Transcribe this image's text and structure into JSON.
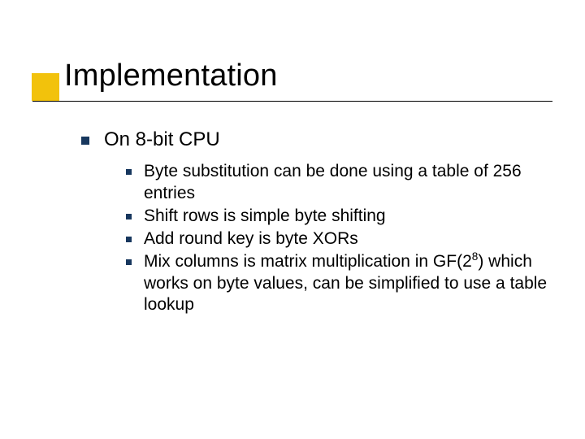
{
  "title": "Implementation",
  "bullets": {
    "level1": "On 8-bit CPU",
    "level2": [
      "Byte substitution can be done using a table of 256 entries",
      "Shift rows is simple byte shifting",
      "Add round key is byte XORs"
    ],
    "level2_mix_prefix": "Mix columns is matrix multiplication in GF(2",
    "level2_mix_sup": "8",
    "level2_mix_suffix": ") which works on byte values, can be simplified to use a table lookup"
  },
  "colors": {
    "accent": "#f2c20c",
    "bullet": "#17375e"
  }
}
